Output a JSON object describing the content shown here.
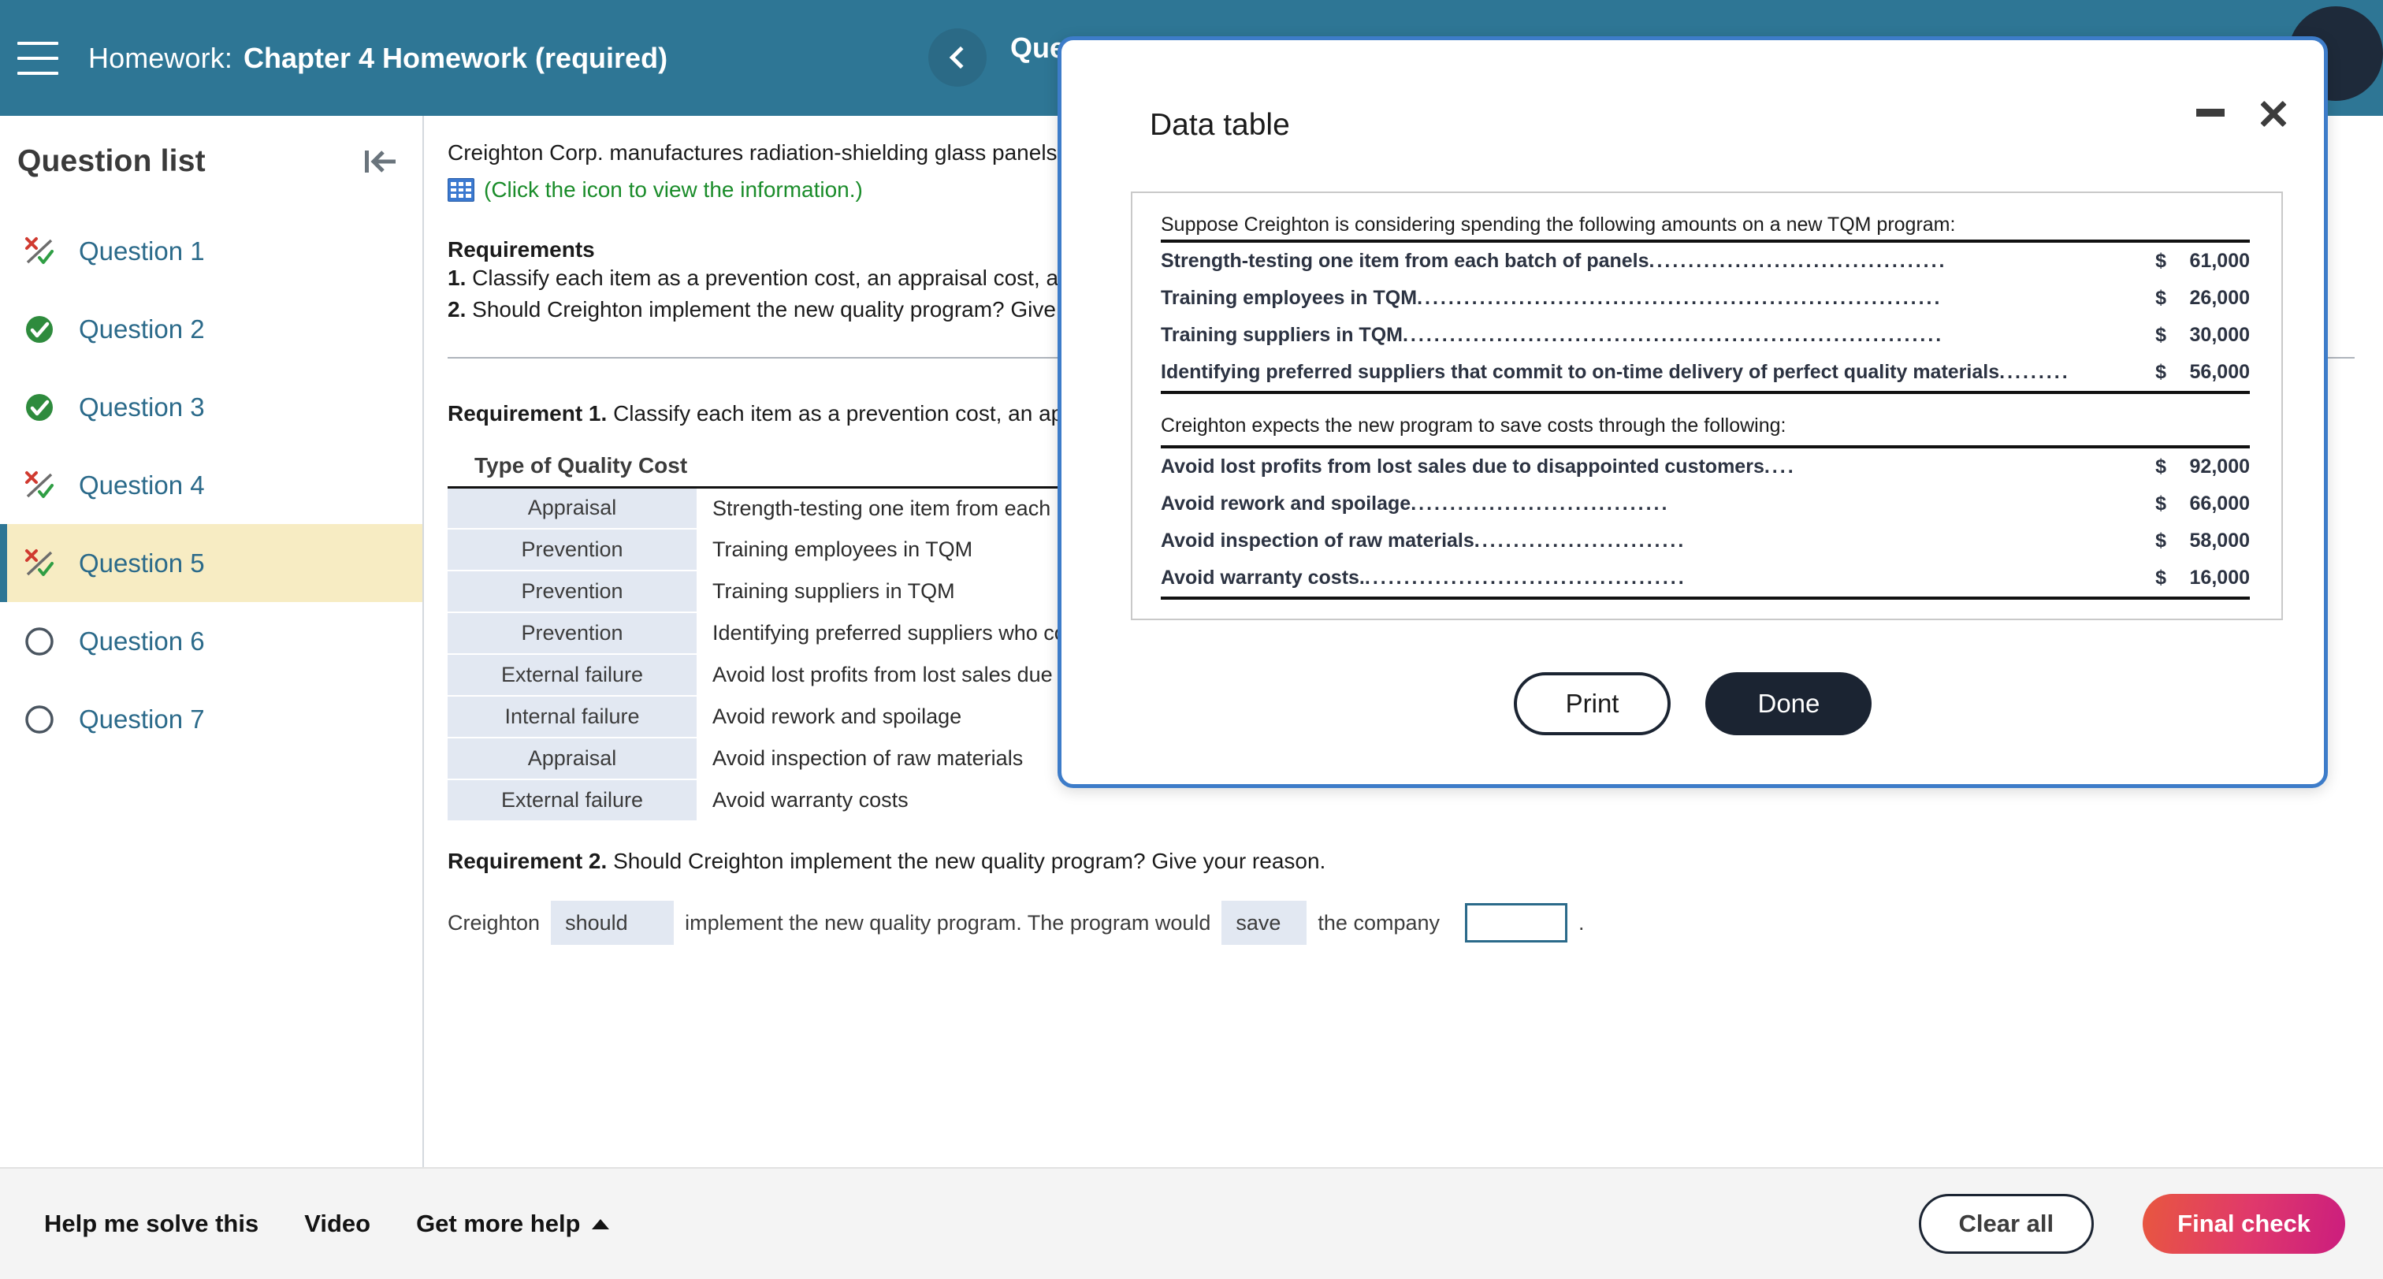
{
  "header": {
    "menu_icon": "hamburger-icon",
    "prefix": "Homework:",
    "title": "Chapter 4 Homework (required)",
    "nav_back_icon": "chevron-left-icon",
    "nav_title": "Question"
  },
  "sidebar": {
    "title": "Question list",
    "collapse_icon": "collapse-panel-icon",
    "items": [
      {
        "label": "Question 1",
        "status": "partial"
      },
      {
        "label": "Question 2",
        "status": "correct"
      },
      {
        "label": "Question 3",
        "status": "correct"
      },
      {
        "label": "Question 4",
        "status": "partial"
      },
      {
        "label": "Question 5",
        "status": "partial"
      },
      {
        "label": "Question 6",
        "status": "unanswered"
      },
      {
        "label": "Question 7",
        "status": "unanswered"
      }
    ],
    "selected_index": 4
  },
  "main": {
    "intro": "Creighton Corp. manufactures radiation-shielding glass panels.",
    "info_icon": "data-table-grid-icon",
    "info_link": "(Click the icon to view the information.)",
    "requirements_heading": "Requirements",
    "requirements": [
      {
        "num": "1.",
        "text": "Classify each item as a prevention cost, an appraisal cost, an int"
      },
      {
        "num": "2.",
        "text": "Should Creighton implement the new quality program? Give your"
      }
    ],
    "req1_label": "Requirement 1.",
    "req1_text": "Classify each item as a prevention cost, an apprai",
    "table_column_header": "Type of Quality Cost",
    "table_rows": [
      {
        "type": "Appraisal",
        "desc": "Strength-testing one item from each batc"
      },
      {
        "type": "Prevention",
        "desc": "Training employees in TQM"
      },
      {
        "type": "Prevention",
        "desc": "Training suppliers in TQM"
      },
      {
        "type": "Prevention",
        "desc": "Identifying preferred suppliers who comm"
      },
      {
        "type": "External failure",
        "desc": "Avoid lost profits from lost sales due to d"
      },
      {
        "type": "Internal failure",
        "desc": "Avoid rework and spoilage"
      },
      {
        "type": "Appraisal",
        "desc": "Avoid inspection of raw materials"
      },
      {
        "type": "External failure",
        "desc": "Avoid warranty costs"
      }
    ],
    "req2_label": "Requirement 2.",
    "req2_text": "Should Creighton implement the new quality program? Give your reason.",
    "answer": {
      "lead": "Creighton",
      "dropdown1": "should",
      "mid": "implement the new quality program. The program would",
      "dropdown2": "save",
      "tail": "the company",
      "input_value": "",
      "period": "."
    }
  },
  "modal": {
    "title": "Data table",
    "minimize_icon": "minimize-icon",
    "close_icon": "close-icon",
    "intro": "Suppose Creighton is considering spending the following amounts on a new TQM program:",
    "cost_items": [
      {
        "label": "Strength-testing one item from each batch of panels",
        "currency": "$",
        "amount": "61,000"
      },
      {
        "label": "Training employees in TQM",
        "currency": "$",
        "amount": "26,000"
      },
      {
        "label": "Training suppliers in TQM",
        "currency": "$",
        "amount": "30,000"
      },
      {
        "label": "Identifying preferred suppliers that commit to on-time delivery of perfect quality materials",
        "currency": "$",
        "amount": "56,000"
      }
    ],
    "savings_intro": "Creighton expects the new program to save costs through the following:",
    "savings_items": [
      {
        "label": "Avoid lost profits from lost sales due to disappointed customers",
        "currency": "$",
        "amount": "92,000"
      },
      {
        "label": "Avoid rework and spoilage",
        "currency": "$",
        "amount": "66,000"
      },
      {
        "label": "Avoid inspection of raw materials",
        "currency": "$",
        "amount": "58,000"
      },
      {
        "label": "Avoid warranty costs.",
        "currency": "$",
        "amount": "16,000"
      }
    ],
    "print_label": "Print",
    "done_label": "Done"
  },
  "bottombar": {
    "help_solve": "Help me solve this",
    "video": "Video",
    "get_more_help": "Get more help",
    "get_more_help_icon": "caret-up-icon",
    "clear_all": "Clear all",
    "final_check": "Final check"
  },
  "colors": {
    "header_bg": "#2e7695",
    "link": "#2b6a8a",
    "selected_row": "#f7ecc3",
    "green": "#1a8c2a",
    "final_check_gradient_start": "#e8573f",
    "final_check_gradient_end": "#cb1d7e",
    "modal_border": "#3d7cc9"
  }
}
